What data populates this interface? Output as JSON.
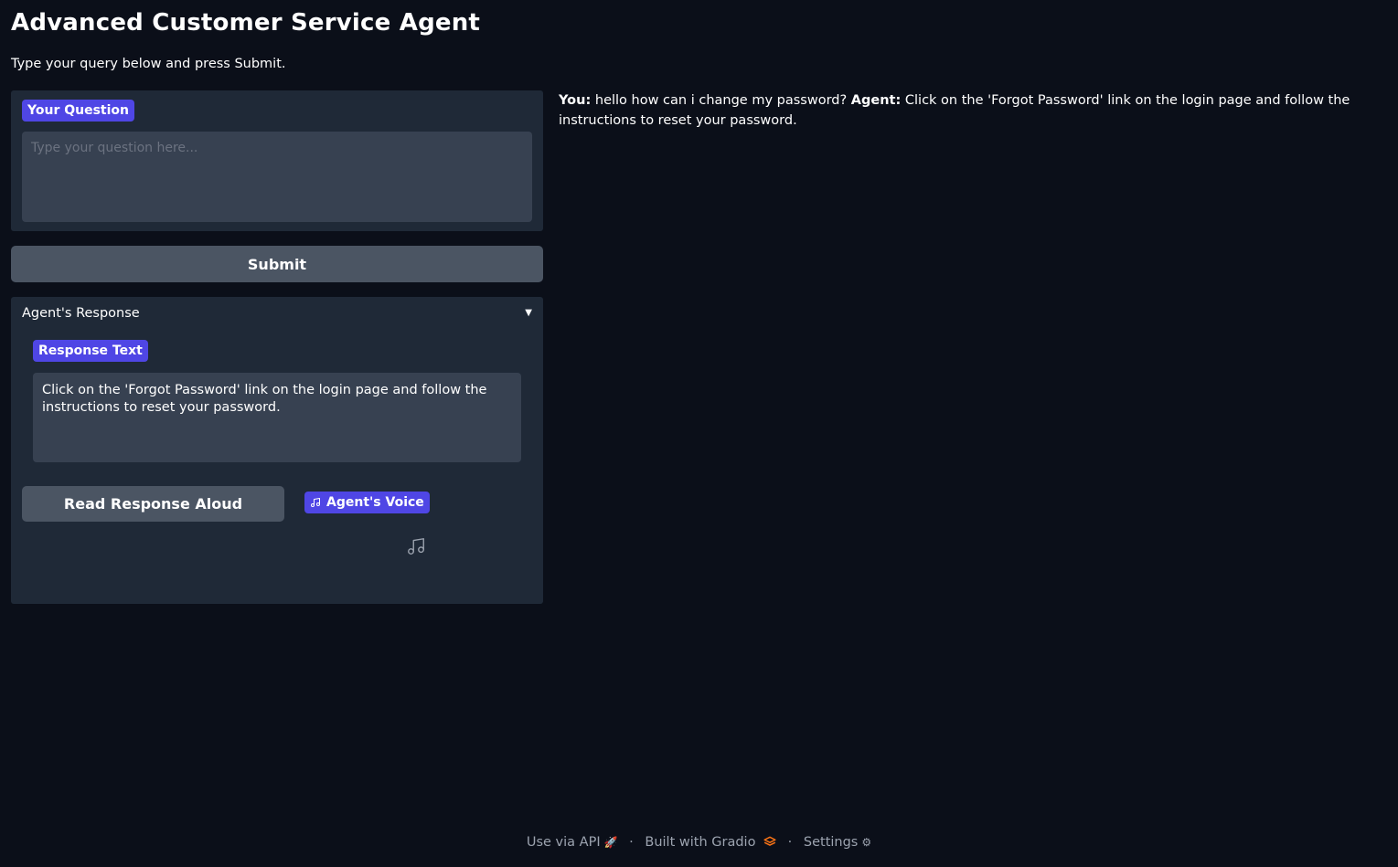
{
  "header": {
    "title": "Advanced Customer Service Agent",
    "subtitle": "Type your query below and press Submit."
  },
  "question": {
    "label": "Your Question",
    "value": "",
    "placeholder": "Type your question here..."
  },
  "submit": {
    "label": "Submit"
  },
  "response_panel": {
    "accordion_label": "Agent's Response",
    "arrow": "▼",
    "text_label": "Response Text",
    "text_value": "Click on the 'Forgot Password' link on the login page and follow the instructions to reset your password.",
    "read_button_label": "Read Response Aloud",
    "voice_label": "Agent's Voice",
    "voice_icon": "music-note-icon",
    "audio_placeholder_icon": "music-note-icon"
  },
  "chat": {
    "user_prefix": "You:",
    "user_message": "hello how can i change my password?",
    "agent_prefix": "Agent:",
    "agent_message": "Click on the 'Forgot Password' link on the login page and follow the instructions to reset your password."
  },
  "footer": {
    "api_label": "Use via API",
    "api_icon": "rocket-icon",
    "separator": "·",
    "built_label": "Built with Gradio",
    "built_icon": "gradio-logo-icon",
    "settings_label": "Settings",
    "settings_icon": "gear-icon"
  },
  "colors": {
    "background": "#0b0f19",
    "panel": "#1f2937",
    "input": "#374151",
    "button": "#4b5563",
    "accent": "#4f46e5",
    "footer_text": "#9ca3af",
    "gradio_orange": "#f97316"
  }
}
